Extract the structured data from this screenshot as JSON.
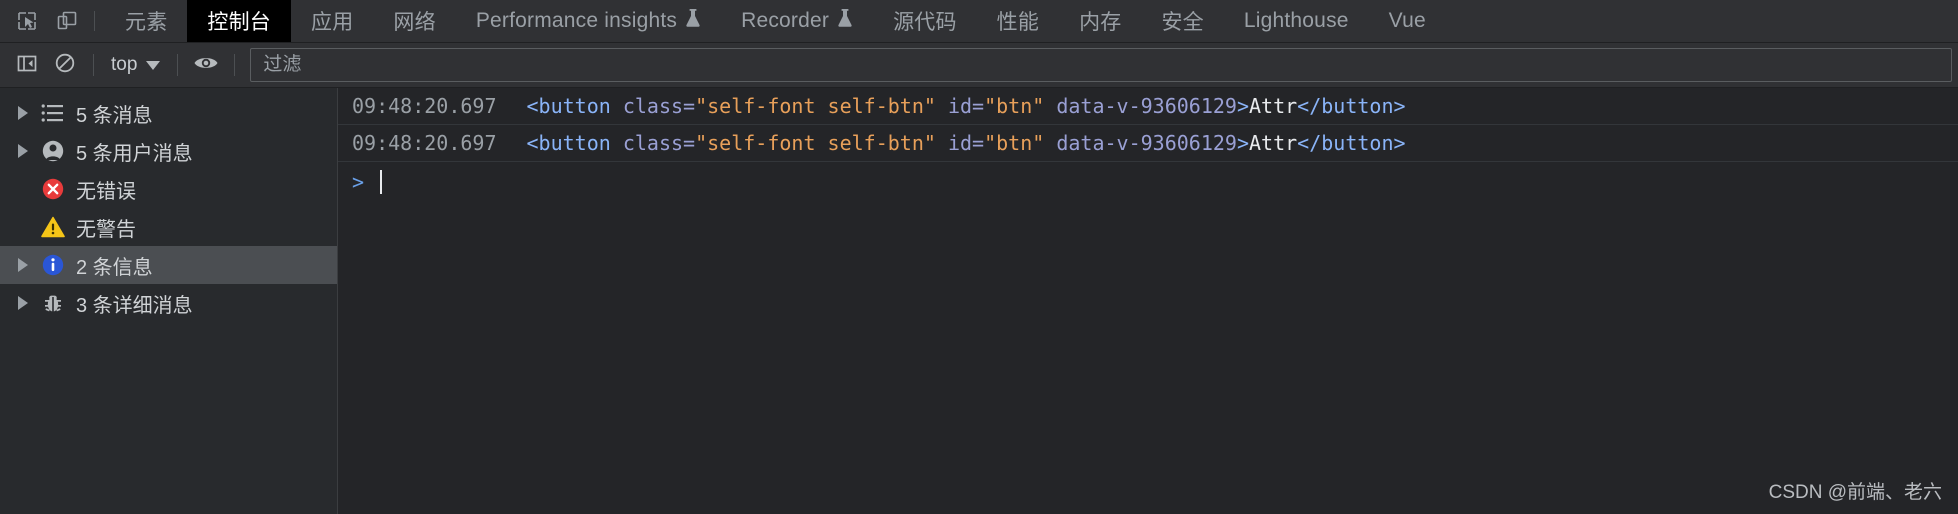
{
  "tabbar": {
    "inspect_icon": "inspect-element-icon",
    "device_icon": "device-toolbar-icon",
    "tabs": [
      {
        "label": "元素",
        "active": false,
        "flask": false
      },
      {
        "label": "控制台",
        "active": true,
        "flask": false
      },
      {
        "label": "应用",
        "active": false,
        "flask": false
      },
      {
        "label": "网络",
        "active": false,
        "flask": false
      },
      {
        "label": "Performance insights",
        "active": false,
        "flask": true
      },
      {
        "label": "Recorder",
        "active": false,
        "flask": true
      },
      {
        "label": "源代码",
        "active": false,
        "flask": false
      },
      {
        "label": "性能",
        "active": false,
        "flask": false
      },
      {
        "label": "内存",
        "active": false,
        "flask": false
      },
      {
        "label": "安全",
        "active": false,
        "flask": false
      },
      {
        "label": "Lighthouse",
        "active": false,
        "flask": false
      },
      {
        "label": "Vue",
        "active": false,
        "flask": false
      }
    ]
  },
  "toolbar": {
    "sidebar_toggle_icon": "console-sidebar-toggle-icon",
    "clear_icon": "clear-console-icon",
    "context_label": "top",
    "eye_icon": "live-expression-eye-icon",
    "filter_placeholder": "过滤",
    "filter_value": ""
  },
  "sidebar": {
    "items": [
      {
        "label": "5 条消息",
        "icon": "message-list-icon",
        "twisty": true,
        "selected": false
      },
      {
        "label": "5 条用户消息",
        "icon": "user-message-icon",
        "twisty": true,
        "selected": false
      },
      {
        "label": "无错误",
        "icon": "error-icon",
        "twisty": false,
        "selected": false
      },
      {
        "label": "无警告",
        "icon": "warning-icon",
        "twisty": false,
        "selected": false
      },
      {
        "label": "2 条信息",
        "icon": "info-icon",
        "twisty": true,
        "selected": true
      },
      {
        "label": "3 条详细消息",
        "icon": "verbose-bug-icon",
        "twisty": true,
        "selected": false
      }
    ]
  },
  "console": {
    "messages": [
      {
        "timestamp": "09:48:20.697",
        "tag_open": "<button ",
        "attr1_name": "class=",
        "attr1_value": "\"self-font self-btn\"",
        "attr2_name": " id=",
        "attr2_value": "\"btn\"",
        "attr3_name": " data-v-93606129",
        "tag_open_end": ">",
        "text": "Attr",
        "tag_close": "</button>"
      },
      {
        "timestamp": "09:48:20.697",
        "tag_open": "<button ",
        "attr1_name": "class=",
        "attr1_value": "\"self-font self-btn\"",
        "attr2_name": " id=",
        "attr2_value": "\"btn\"",
        "attr3_name": " data-v-93606129",
        "tag_open_end": ">",
        "text": "Attr",
        "tag_close": "</button>"
      }
    ],
    "prompt_chevron": ">",
    "prompt_value": ""
  },
  "watermark": "CSDN @前端、老六",
  "colors": {
    "tab_active_bg": "#000000",
    "panel_bg": "#242528",
    "toolbar_bg": "#303134",
    "sidebar_bg": "#282a2d",
    "selected_bg": "#4b4e52",
    "error_red": "#e83b3b",
    "warning_yellow": "#f5c518",
    "info_blue": "#2a56d6",
    "tag_blue": "#8ab4f8",
    "attr_value_orange": "#e8a05a"
  }
}
